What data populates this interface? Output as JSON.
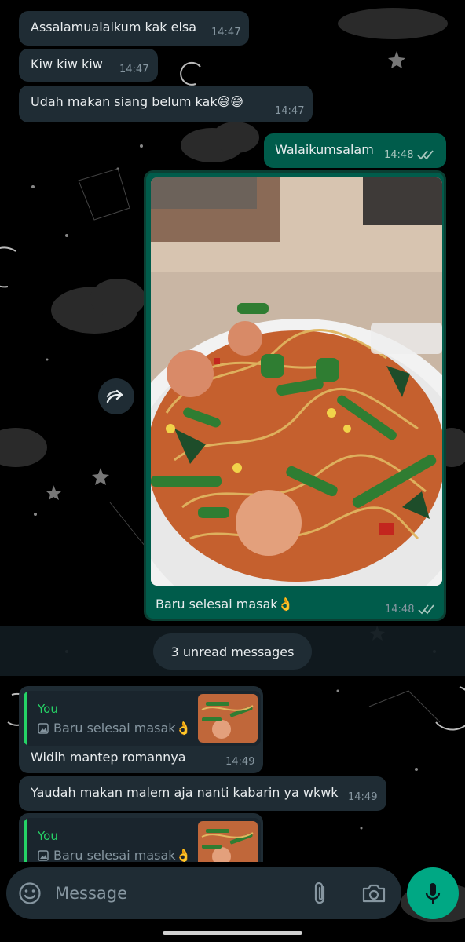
{
  "colors": {
    "incoming": "#1f2c34",
    "outgoing": "#005c4b",
    "accent": "#25d366",
    "mic": "#00a884"
  },
  "messages": [
    {
      "text": "Assalamualaikum kak elsa",
      "time": "14:47",
      "dir": "in"
    },
    {
      "text": "Kiw kiw kiw",
      "time": "14:47",
      "dir": "in"
    },
    {
      "text": "Udah makan siang belum kak",
      "emoji": "😅😅",
      "time": "14:47",
      "dir": "in"
    },
    {
      "text": "Walaikumsalam",
      "time": "14:48",
      "dir": "out",
      "status": "read"
    },
    {
      "text": "Baru selesai masak",
      "emoji": "👌",
      "time": "14:48",
      "dir": "out",
      "status": "read",
      "media": "photo-noodles"
    }
  ],
  "forward_icon": "forward-icon",
  "unread": "3 unread messages",
  "replies": [
    {
      "quote_author": "You",
      "quote_text": "Baru selesai masak",
      "quote_emoji": "👌",
      "text": "Widih mantep romannya",
      "time": "14:49"
    },
    {
      "text": "Yaudah makan malem aja nanti kabarin ya wkwk",
      "time": "14:49"
    },
    {
      "quote_author": "You",
      "quote_text": "Baru selesai masak",
      "quote_emoji": "👌"
    }
  ],
  "composer": {
    "placeholder": "Message",
    "icons": [
      "emoji-icon",
      "attach-icon",
      "camera-icon",
      "mic-icon"
    ]
  }
}
